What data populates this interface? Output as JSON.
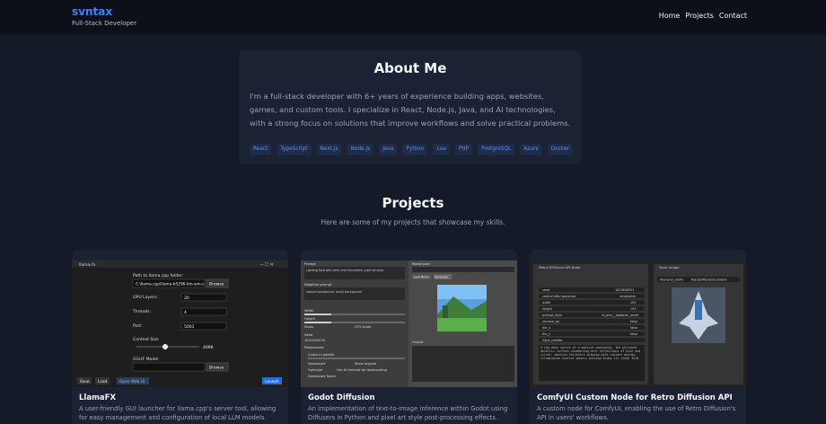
{
  "header": {
    "brand": "svntax",
    "subtitle": "Full-Stack Developer",
    "nav": [
      "Home",
      "Projects",
      "Contact"
    ]
  },
  "about": {
    "title": "About Me",
    "text": "I'm a full-stack developer with 6+ years of experience building apps, websites, games, and custom tools. I specialize in React, Node.js, Java, and AI technologies, with a strong focus on solutions that improve workflows and solve practical problems.",
    "tags": [
      "React",
      "TypeScript",
      "Next.js",
      "Node.js",
      "Java",
      "Python",
      "Lua",
      "PHP",
      "PostgreSQL",
      "Azure",
      "Docker"
    ]
  },
  "projects": {
    "title": "Projects",
    "subtitle": "Here are some of my projects that showcase my skills.",
    "items": [
      {
        "title": "LlamaFX",
        "desc": "A user-friendly GUI launcher for llama.cpp's server tool, allowing for easy management and configuration of local LLM models.",
        "shot": {
          "window_title": "llama-fx",
          "path_label": "Path to llama.cpp folder:",
          "path_value": "C:\\llama.cpp\\llama-b5296-bin-win-c",
          "browse": "Browse",
          "gpu_label": "GPU Layers:",
          "gpu_value": "20",
          "threads_label": "Threads:",
          "threads_value": "4",
          "port_label": "Port:",
          "port_value": "5001",
          "ctx_label": "Context Size",
          "ctx_value": "4096",
          "gguf_label": "GGUF Model",
          "browse2": "Browse",
          "btn_save": "Save",
          "btn_load": "Load",
          "btn_open": "Open Web UI",
          "btn_launch": "Launch"
        }
      },
      {
        "title": "Godot Diffusion",
        "desc": "An implementation of text-to-image inference within Godot using Diffusers in Python and pixel art style post-processing effects.",
        "shot": {
          "prompt_label": "Prompt",
          "prompt_value": "Lighting field with trees and mountains, pixel art style",
          "neg_label": "Negative prompt",
          "neg_value": "natural background, dusty background",
          "model_label": "Model path",
          "load": "Load Model",
          "generate": "Generate",
          "width": "Width",
          "height": "Height",
          "steps": "Steps",
          "cfg": "CFG Scale",
          "seed": "Seed",
          "seed_value": "1841269236",
          "postprocess": "Postprocess",
          "colors": "Colors in palette",
          "downscale": "Downscale",
          "show_original": "Show original",
          "optimize": "Optimize",
          "use_k": "Use K-Centroid for downscaling",
          "factor": "Downscale factor",
          "output": "Output"
        }
      },
      {
        "title": "ComfyUI Custom Node for Retro Diffusion API",
        "desc": "A custom node for ComfyUI, enabling the use of Retro Diffusion's API in users' workflows.",
        "shot": {
          "node1": "Retro Diffusion API Node",
          "node2": "Save Image",
          "fields": [
            "seed",
            "control after generate",
            "width",
            "height",
            "prompt_style",
            "remove_bg",
            "tile_x",
            "tile_y",
            "input_palette"
          ],
          "values": [
            "1823836591",
            "randomize",
            "192",
            "192",
            "rd_plus__topdown_asset",
            "false",
            "false",
            "false",
            ""
          ],
          "prefix_label": "filename_prefix",
          "prefix_value": "RetroDiffusion/ComfyUI",
          "prompt": "A top-down sprite of a massive spaceship, the polished metallic surface shimmering with reflections of blue and silver, massive thrusters glowing with vibrant energy, illuminated control panels pulsing along its sleek form"
        }
      }
    ]
  },
  "colors": {
    "background": "#151a28",
    "header": "#0d1019",
    "card": "#1b2233",
    "accent": "#3b82f6",
    "tag_bg": "#1f2b47"
  }
}
